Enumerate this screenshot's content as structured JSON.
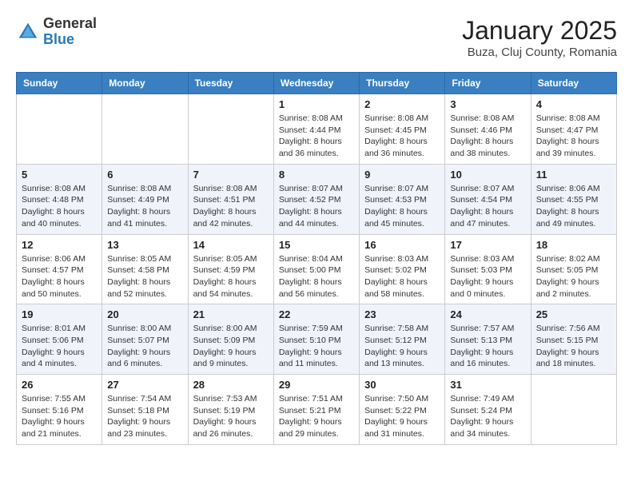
{
  "header": {
    "logo_general": "General",
    "logo_blue": "Blue",
    "month_title": "January 2025",
    "location": "Buza, Cluj County, Romania"
  },
  "days_of_week": [
    "Sunday",
    "Monday",
    "Tuesday",
    "Wednesday",
    "Thursday",
    "Friday",
    "Saturday"
  ],
  "weeks": [
    [
      {
        "day": "",
        "empty": true
      },
      {
        "day": "",
        "empty": true
      },
      {
        "day": "",
        "empty": true
      },
      {
        "day": "1",
        "sunrise": "8:08 AM",
        "sunset": "4:44 PM",
        "daylight": "8 hours and 36 minutes."
      },
      {
        "day": "2",
        "sunrise": "8:08 AM",
        "sunset": "4:45 PM",
        "daylight": "8 hours and 36 minutes."
      },
      {
        "day": "3",
        "sunrise": "8:08 AM",
        "sunset": "4:46 PM",
        "daylight": "8 hours and 38 minutes."
      },
      {
        "day": "4",
        "sunrise": "8:08 AM",
        "sunset": "4:47 PM",
        "daylight": "8 hours and 39 minutes."
      }
    ],
    [
      {
        "day": "5",
        "sunrise": "8:08 AM",
        "sunset": "4:48 PM",
        "daylight": "8 hours and 40 minutes."
      },
      {
        "day": "6",
        "sunrise": "8:08 AM",
        "sunset": "4:49 PM",
        "daylight": "8 hours and 41 minutes."
      },
      {
        "day": "7",
        "sunrise": "8:08 AM",
        "sunset": "4:51 PM",
        "daylight": "8 hours and 42 minutes."
      },
      {
        "day": "8",
        "sunrise": "8:07 AM",
        "sunset": "4:52 PM",
        "daylight": "8 hours and 44 minutes."
      },
      {
        "day": "9",
        "sunrise": "8:07 AM",
        "sunset": "4:53 PM",
        "daylight": "8 hours and 45 minutes."
      },
      {
        "day": "10",
        "sunrise": "8:07 AM",
        "sunset": "4:54 PM",
        "daylight": "8 hours and 47 minutes."
      },
      {
        "day": "11",
        "sunrise": "8:06 AM",
        "sunset": "4:55 PM",
        "daylight": "8 hours and 49 minutes."
      }
    ],
    [
      {
        "day": "12",
        "sunrise": "8:06 AM",
        "sunset": "4:57 PM",
        "daylight": "8 hours and 50 minutes."
      },
      {
        "day": "13",
        "sunrise": "8:05 AM",
        "sunset": "4:58 PM",
        "daylight": "8 hours and 52 minutes."
      },
      {
        "day": "14",
        "sunrise": "8:05 AM",
        "sunset": "4:59 PM",
        "daylight": "8 hours and 54 minutes."
      },
      {
        "day": "15",
        "sunrise": "8:04 AM",
        "sunset": "5:00 PM",
        "daylight": "8 hours and 56 minutes."
      },
      {
        "day": "16",
        "sunrise": "8:03 AM",
        "sunset": "5:02 PM",
        "daylight": "8 hours and 58 minutes."
      },
      {
        "day": "17",
        "sunrise": "8:03 AM",
        "sunset": "5:03 PM",
        "daylight": "9 hours and 0 minutes."
      },
      {
        "day": "18",
        "sunrise": "8:02 AM",
        "sunset": "5:05 PM",
        "daylight": "9 hours and 2 minutes."
      }
    ],
    [
      {
        "day": "19",
        "sunrise": "8:01 AM",
        "sunset": "5:06 PM",
        "daylight": "9 hours and 4 minutes."
      },
      {
        "day": "20",
        "sunrise": "8:00 AM",
        "sunset": "5:07 PM",
        "daylight": "9 hours and 6 minutes."
      },
      {
        "day": "21",
        "sunrise": "8:00 AM",
        "sunset": "5:09 PM",
        "daylight": "9 hours and 9 minutes."
      },
      {
        "day": "22",
        "sunrise": "7:59 AM",
        "sunset": "5:10 PM",
        "daylight": "9 hours and 11 minutes."
      },
      {
        "day": "23",
        "sunrise": "7:58 AM",
        "sunset": "5:12 PM",
        "daylight": "9 hours and 13 minutes."
      },
      {
        "day": "24",
        "sunrise": "7:57 AM",
        "sunset": "5:13 PM",
        "daylight": "9 hours and 16 minutes."
      },
      {
        "day": "25",
        "sunrise": "7:56 AM",
        "sunset": "5:15 PM",
        "daylight": "9 hours and 18 minutes."
      }
    ],
    [
      {
        "day": "26",
        "sunrise": "7:55 AM",
        "sunset": "5:16 PM",
        "daylight": "9 hours and 21 minutes."
      },
      {
        "day": "27",
        "sunrise": "7:54 AM",
        "sunset": "5:18 PM",
        "daylight": "9 hours and 23 minutes."
      },
      {
        "day": "28",
        "sunrise": "7:53 AM",
        "sunset": "5:19 PM",
        "daylight": "9 hours and 26 minutes."
      },
      {
        "day": "29",
        "sunrise": "7:51 AM",
        "sunset": "5:21 PM",
        "daylight": "9 hours and 29 minutes."
      },
      {
        "day": "30",
        "sunrise": "7:50 AM",
        "sunset": "5:22 PM",
        "daylight": "9 hours and 31 minutes."
      },
      {
        "day": "31",
        "sunrise": "7:49 AM",
        "sunset": "5:24 PM",
        "daylight": "9 hours and 34 minutes."
      },
      {
        "day": "",
        "empty": true
      }
    ]
  ]
}
